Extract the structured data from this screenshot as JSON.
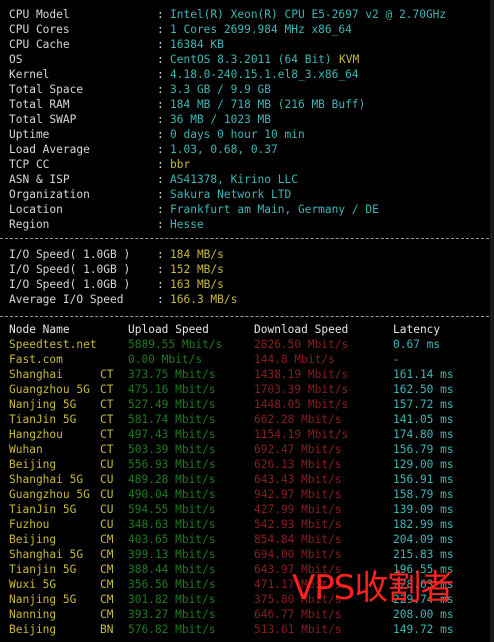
{
  "sysinfo": [
    {
      "label": "CPU Model",
      "value": "Intel(R) Xeon(R) CPU E5-2697 v2 @ 2.70GHz"
    },
    {
      "label": "CPU Cores",
      "value": "1 Cores 2699.984 MHz x86_64"
    },
    {
      "label": "CPU Cache",
      "value": "16384 KB"
    },
    {
      "label": "OS",
      "value": "CentOS 8.3.2011 (64 Bit)",
      "extra": "KVM"
    },
    {
      "label": "Kernel",
      "value": "4.18.0-240.15.1.el8_3.x86_64"
    },
    {
      "label": "Total Space",
      "value": "3.3 GB / 9.9 GB"
    },
    {
      "label": "Total RAM",
      "value": "184 MB / 718 MB (216 MB Buff)"
    },
    {
      "label": "Total SWAP",
      "value": "36 MB / 1023 MB"
    },
    {
      "label": "Uptime",
      "value": "0 days 0 hour 10 min"
    },
    {
      "label": "Load Average",
      "value": "1.03, 0.68, 0.37"
    },
    {
      "label": "TCP CC",
      "value": "bbr"
    },
    {
      "label": "ASN & ISP",
      "value": "AS41378, Kirino LLC"
    },
    {
      "label": "Organization",
      "value": "Sakura Network LTD"
    },
    {
      "label": "Location",
      "value": "Frankfurt am Main, Germany / DE"
    },
    {
      "label": "Region",
      "value": "Hesse"
    }
  ],
  "io": [
    {
      "label": "I/O Speed( 1.0GB )",
      "value": "184 MB/s"
    },
    {
      "label": "I/O Speed( 1.0GB )",
      "value": "152 MB/s"
    },
    {
      "label": "I/O Speed( 1.0GB )",
      "value": "163 MB/s"
    },
    {
      "label": "Average I/O Speed",
      "value": "166.3 MB/s"
    }
  ],
  "speed_headers": {
    "node": "Node Name",
    "upload": "Upload Speed",
    "download": "Download Speed",
    "latency": "Latency"
  },
  "speed_rows": [
    {
      "node": "Speedtest.net",
      "isp": "",
      "upload": "5889.55 Mbit/s",
      "download": "2826.50 Mbit/s",
      "latency": "0.67 ms"
    },
    {
      "node": "Fast.com",
      "isp": "",
      "upload": "0.00 Mbit/s",
      "download": "144.8 Mbit/s",
      "latency": "-"
    },
    {
      "node": "Shanghai",
      "isp": "CT",
      "upload": "373.75 Mbit/s",
      "download": "1438.19 Mbit/s",
      "latency": "161.14 ms"
    },
    {
      "node": "Guangzhou 5G",
      "isp": "CT",
      "upload": "475.16 Mbit/s",
      "download": "1703.39 Mbit/s",
      "latency": "162.50 ms"
    },
    {
      "node": "Nanjing 5G",
      "isp": "CT",
      "upload": "527.49 Mbit/s",
      "download": "1448.05 Mbit/s",
      "latency": "157.72 ms"
    },
    {
      "node": "TianJin 5G",
      "isp": "CT",
      "upload": "581.74 Mbit/s",
      "download": "662.28 Mbit/s",
      "latency": "141.05 ms"
    },
    {
      "node": "Hangzhou",
      "isp": "CT",
      "upload": "497.43 Mbit/s",
      "download": "1154.19 Mbit/s",
      "latency": "174.80 ms"
    },
    {
      "node": "Wuhan",
      "isp": "CT",
      "upload": "503.39 Mbit/s",
      "download": "692.47 Mbit/s",
      "latency": "156.79 ms"
    },
    {
      "node": "Beijing",
      "isp": "CU",
      "upload": "556.93 Mbit/s",
      "download": "626.13 Mbit/s",
      "latency": "129.00 ms"
    },
    {
      "node": "Shanghai 5G",
      "isp": "CU",
      "upload": "489.28 Mbit/s",
      "download": "643.43 Mbit/s",
      "latency": "156.91 ms"
    },
    {
      "node": "Guangzhou 5G",
      "isp": "CU",
      "upload": "490.04 Mbit/s",
      "download": "942.97 Mbit/s",
      "latency": "158.79 ms"
    },
    {
      "node": "TianJin 5G",
      "isp": "CU",
      "upload": "594.55 Mbit/s",
      "download": "427.99 Mbit/s",
      "latency": "139.09 ms"
    },
    {
      "node": "Fuzhou",
      "isp": "CU",
      "upload": "348.63 Mbit/s",
      "download": "542.93 Mbit/s",
      "latency": "182.99 ms"
    },
    {
      "node": "Beijing",
      "isp": "CM",
      "upload": "403.65 Mbit/s",
      "download": "854.84 Mbit/s",
      "latency": "204.09 ms"
    },
    {
      "node": "Shanghai 5G",
      "isp": "CM",
      "upload": "399.13 Mbit/s",
      "download": "694.00 Mbit/s",
      "latency": "215.83 ms"
    },
    {
      "node": "Tianjin 5G",
      "isp": "CM",
      "upload": "388.44 Mbit/s",
      "download": "643.97 Mbit/s",
      "latency": "196.55 ms"
    },
    {
      "node": "Wuxi 5G",
      "isp": "CM",
      "upload": "356.56 Mbit/s",
      "download": "471.17 Mbit/s",
      "latency": "228.63 ms"
    },
    {
      "node": "Nanjing 5G",
      "isp": "CM",
      "upload": "301.82 Mbit/s",
      "download": "375.80 Mbit/s",
      "latency": "229.74 ms"
    },
    {
      "node": "Nanning",
      "isp": "CM",
      "upload": "393.27 Mbit/s",
      "download": "646.77 Mbit/s",
      "latency": "208.00 ms"
    },
    {
      "node": "Beijing",
      "isp": "BN",
      "upload": "576.82 Mbit/s",
      "download": "513.61 Mbit/s",
      "latency": "149.72 ms"
    }
  ],
  "watermark": "VPS收割者",
  "colors": {
    "cyan": "#3fb6b6",
    "yellow": "#c8b93a",
    "green": "#33c433",
    "red": "#d03a3a",
    "background": "#000000"
  }
}
